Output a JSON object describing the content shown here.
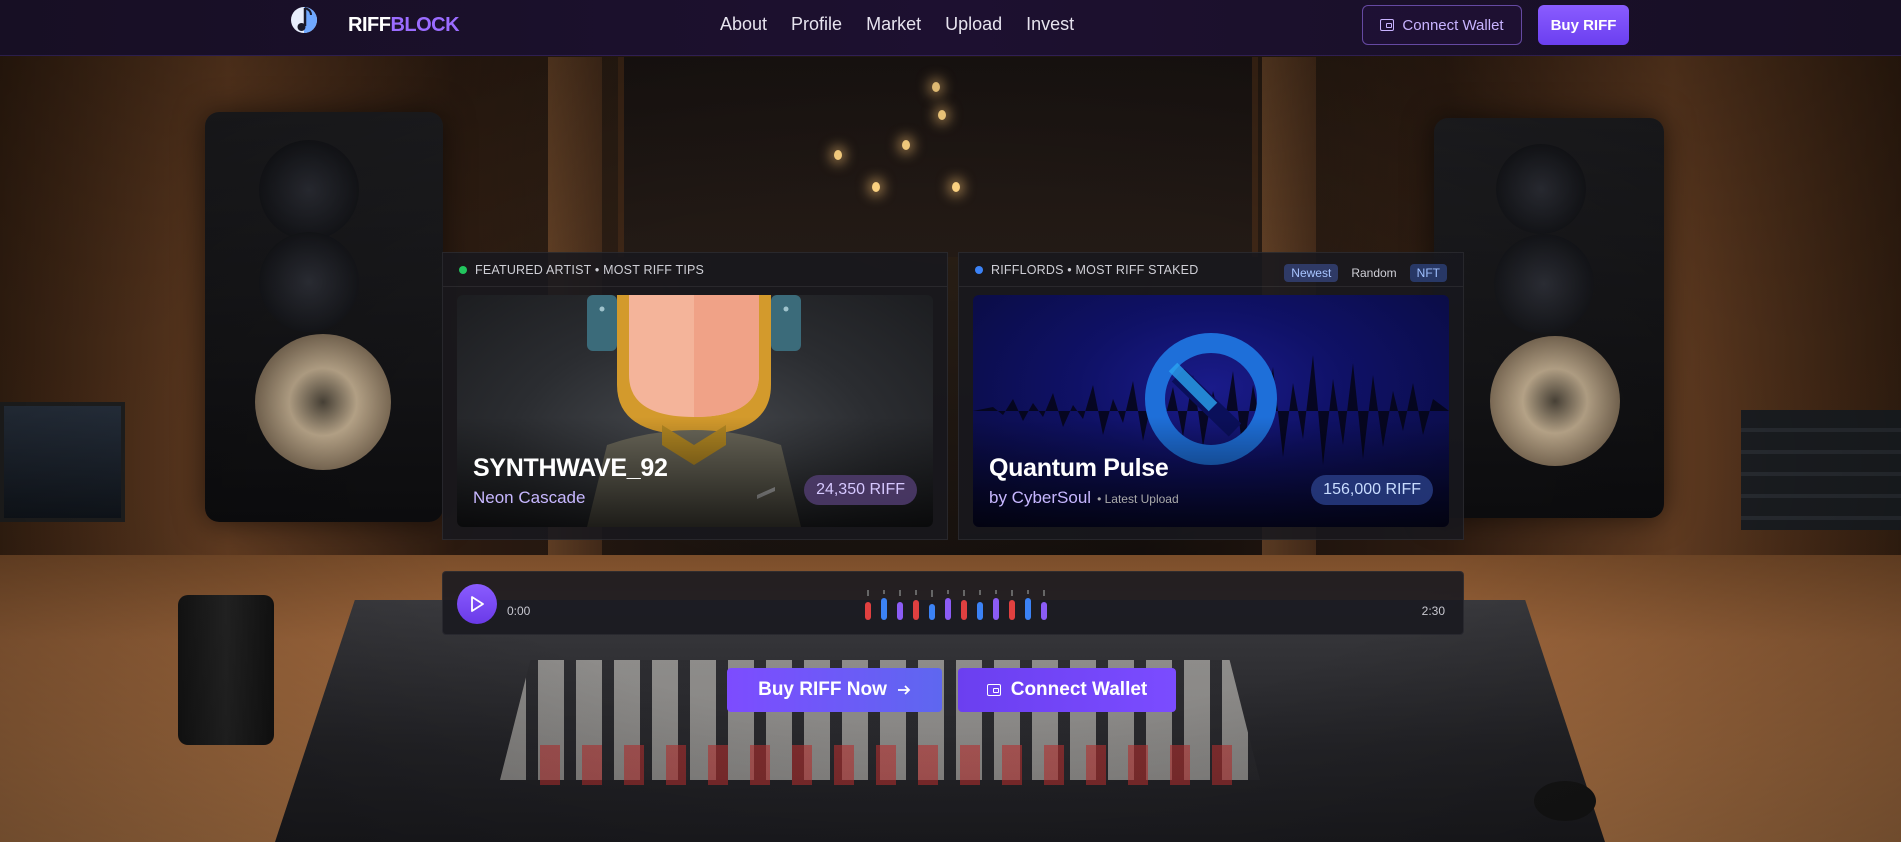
{
  "brand": {
    "name_part1": "RIFF",
    "name_part2": "BLOCK",
    "logo_small_text": "RIFFBLOCK",
    "accent": "#9b6cff"
  },
  "nav": {
    "links": [
      "About",
      "Profile",
      "Market",
      "Upload",
      "Invest"
    ],
    "connect_wallet": "Connect Wallet",
    "buy_riff": "Buy RIFF"
  },
  "featured": {
    "heading": "FEATURED ARTIST • MOST RIFF TIPS",
    "status_color": "#22c55e",
    "artist_name": "SYNTHWAVE_92",
    "track_name": "Neon Cascade",
    "tips": "24,350 RIFF"
  },
  "rifflords": {
    "heading": "RIFFLORDS • MOST RIFF STAKED",
    "status_color": "#3b82f6",
    "filters": [
      "Newest",
      "Random"
    ],
    "active_filter": "Newest",
    "badge": "NFT",
    "track_title": "Quantum Pulse",
    "artist": "by CyberSoul",
    "meta": "• Latest Upload",
    "staked": "156,000 RIFF"
  },
  "player": {
    "current_time": "0:00",
    "duration": "2:30",
    "progress": 0
  },
  "cta": {
    "buy": "Buy RIFF Now",
    "wallet": "Connect Wallet"
  },
  "icons": {
    "logo": "music-note-logo-icon",
    "wallet": "wallet-icon",
    "play": "play-icon",
    "arrow": "arrow-right-icon"
  }
}
